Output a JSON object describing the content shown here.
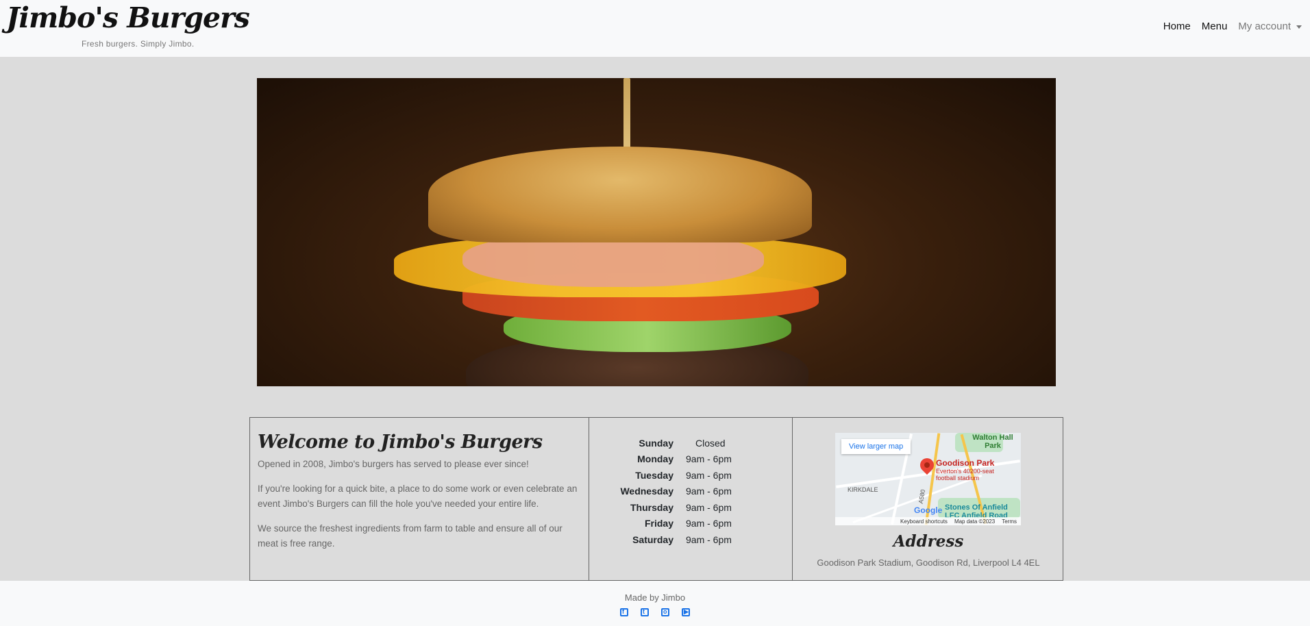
{
  "navbar": {
    "brand": "Jimbo's Burgers",
    "tagline": "Fresh burgers. Simply Jimbo.",
    "links": {
      "home": "Home",
      "menu": "Menu",
      "account": "My account"
    }
  },
  "welcome": {
    "title": "Welcome to Jimbo's Burgers",
    "paragraphs": [
      "Opened in 2008, Jimbo's burgers has served to please ever since!",
      "If you're looking for a quick bite, a place to do some work or even celebrate an event Jimbo's Burgers can fill the hole you've needed your entire life.",
      "We source the freshest ingredients from farm to table and ensure all of our meat is free range."
    ]
  },
  "hours": [
    {
      "day": "Sunday",
      "time": "Closed"
    },
    {
      "day": "Monday",
      "time": "9am - 6pm"
    },
    {
      "day": "Tuesday",
      "time": "9am - 6pm"
    },
    {
      "day": "Wednesday",
      "time": "9am - 6pm"
    },
    {
      "day": "Thursday",
      "time": "9am - 6pm"
    },
    {
      "day": "Friday",
      "time": "9am - 6pm"
    },
    {
      "day": "Saturday",
      "time": "9am - 6pm"
    }
  ],
  "map": {
    "button": "View larger map",
    "place": "Goodison Park",
    "place_sub": "Everton's 40200-seat football stadium",
    "park1": "Walton Hall Park",
    "park2": "Stones Of Anfield LFC Anfield Road",
    "area": "KIRKDALE",
    "road": "A580",
    "google": "Google",
    "footer_shortcuts": "Keyboard shortcuts",
    "footer_data": "Map data ©2023",
    "footer_terms": "Terms"
  },
  "address": {
    "title": "Address",
    "text": "Goodison Park Stadium, Goodison Rd, Liverpool L4 4EL"
  },
  "footer": {
    "made_by": "Made by Jimbo",
    "socials": [
      "facebook-icon",
      "twitter-icon",
      "instagram-icon",
      "youtube-icon"
    ]
  }
}
